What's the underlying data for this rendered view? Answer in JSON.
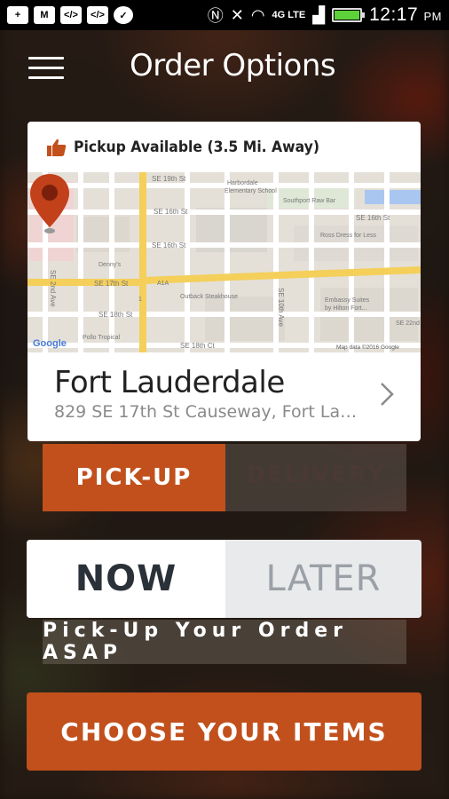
{
  "status_bar": {
    "time": "12:17",
    "ampm": "PM",
    "network": "4G LTE",
    "left_icons": [
      "add-icon",
      "mail-icon",
      "code-icon",
      "code-icon",
      "chat-icon"
    ],
    "right_icons": [
      "nfc-icon",
      "mute-icon",
      "wifi-icon",
      "signal-icon",
      "battery-icon"
    ]
  },
  "header": {
    "title": "Order Options"
  },
  "store_card": {
    "availability": "Pickup Available (3.5 Mi. Away)",
    "store_name": "Fort Lauderdale",
    "address": "829 SE 17th St Causeway, Fort Laud...",
    "map": {
      "labels": [
        "SE 19th St",
        "Harbordale Elementary School",
        "SE 16th St",
        "Southport Raw Bar",
        "SE 16th St",
        "SE 16th St",
        "Ross Dress for Less",
        "Denny's",
        "A1A",
        "SE 17th St",
        "SE 2nd Ave",
        "SE 18th St",
        "Embassy Suites by Hilton Fort...",
        "Outback Steakhouse",
        "SE 10th Ave",
        "Pollo Tropical",
        "SE 18th Ct",
        "SE 22nd",
        "1"
      ],
      "logo": "Google",
      "attribution": "Map data ©2016 Google"
    }
  },
  "order_type": {
    "pickup_label": "PICK-UP",
    "delivery_label": "DELIVERY",
    "selected": "pickup"
  },
  "timing": {
    "now_label": "NOW",
    "later_label": "LATER",
    "selected": "now"
  },
  "instruction": "Pick-Up Your Order ASAP",
  "cta_label": "CHOOSE YOUR ITEMS",
  "colors": {
    "accent": "#c2501c",
    "pin": "#c2401a",
    "road_major": "#f4cf5a"
  }
}
